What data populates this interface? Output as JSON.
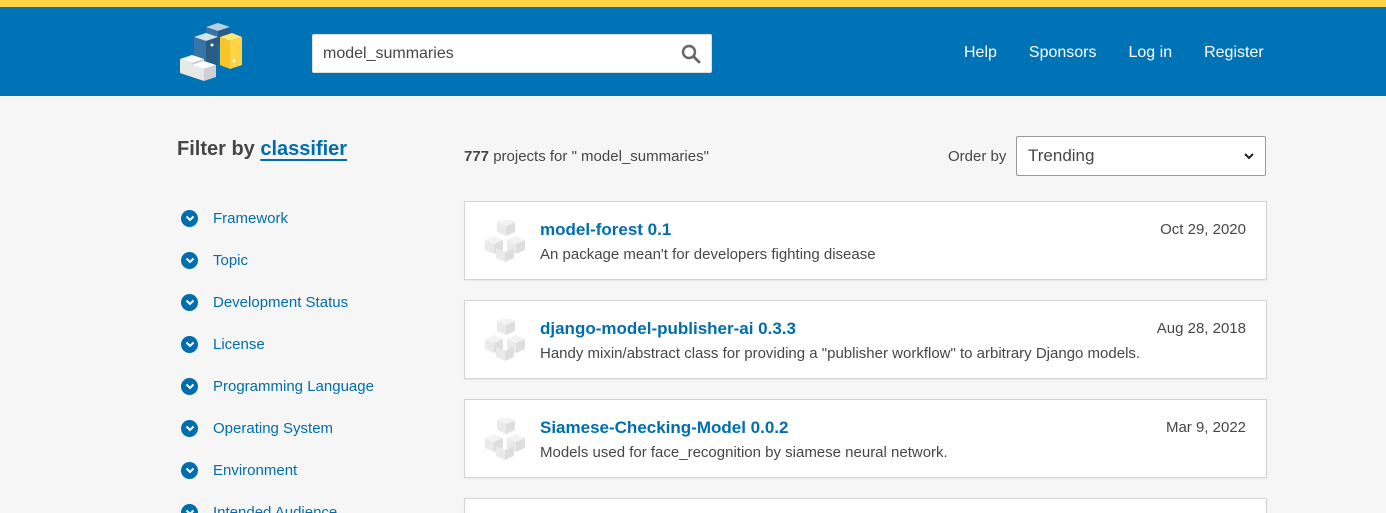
{
  "colors": {
    "header_bg": "#0073b7",
    "top_strip": "#ffd343",
    "link": "#006dad",
    "page_bg": "#f6f6f6"
  },
  "search": {
    "value": "model_summaries",
    "icon": "search-icon"
  },
  "nav": {
    "help": "Help",
    "sponsors": "Sponsors",
    "login": "Log in",
    "register": "Register"
  },
  "filter": {
    "title_prefix": "Filter by",
    "title_link": "classifier",
    "items": [
      {
        "label": "Framework"
      },
      {
        "label": "Topic"
      },
      {
        "label": "Development Status"
      },
      {
        "label": "License"
      },
      {
        "label": "Programming Language"
      },
      {
        "label": "Operating System"
      },
      {
        "label": "Environment"
      },
      {
        "label": "Intended Audience"
      }
    ]
  },
  "results": {
    "count": "777",
    "count_suffix": "projects for \" model_summaries\"",
    "order_label": "Order by",
    "order_value": "Trending",
    "items": [
      {
        "name": "model-forest 0.1",
        "description": "An package mean't for developers fighting disease",
        "date": "Oct 29, 2020"
      },
      {
        "name": "django-model-publisher-ai 0.3.3",
        "description": "Handy mixin/abstract class for providing a \"publisher workflow\" to arbitrary Django models.",
        "date": "Aug 28, 2018"
      },
      {
        "name": "Siamese-Checking-Model 0.0.2",
        "description": "Models used for face_recognition by siamese neural network.",
        "date": "Mar 9, 2022"
      }
    ]
  }
}
